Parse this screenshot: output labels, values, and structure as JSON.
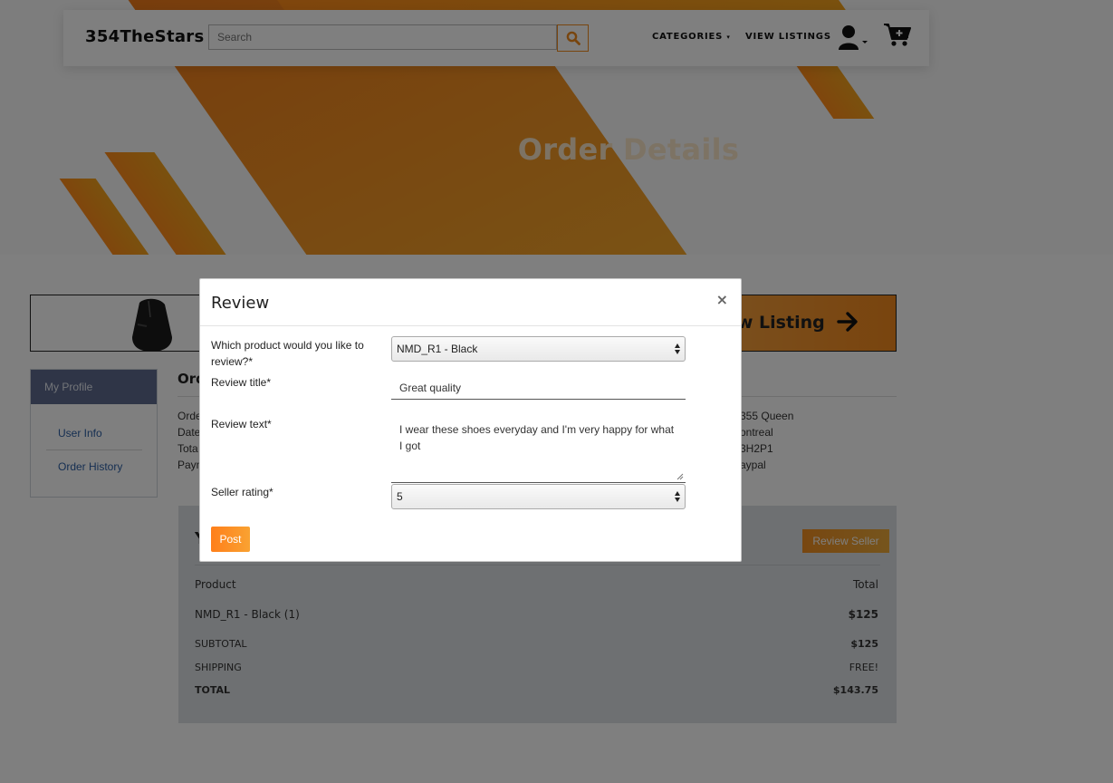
{
  "navbar": {
    "brand": "354TheStars",
    "search_placeholder": "Search",
    "categories_label": "CATEGORIES",
    "view_listings_label": "VIEW LISTINGS"
  },
  "hero": {
    "title": "Order Details"
  },
  "listing_banner": {
    "label": "ew Listing"
  },
  "profile": {
    "header": "My Profile",
    "links": [
      "User Info",
      "Order History"
    ]
  },
  "order": {
    "heading_partial": "Ord",
    "left_fragments": [
      "Orde",
      "Date",
      "Tota",
      "Paym"
    ],
    "right_fragments": [
      "355 Queen",
      "ontreal",
      "3H2P1",
      "aypal"
    ]
  },
  "summary": {
    "heading_partial": "Y",
    "review_seller_label": "Review Seller",
    "col_product": "Product",
    "col_total": "Total",
    "item_name": "NMD_R1 - Black (1)",
    "item_total": "$125",
    "subtotal_label": "SUBTOTAL",
    "subtotal_value": "$125",
    "shipping_label": "SHIPPING",
    "shipping_value": "FREE!",
    "total_label": "TOTAL",
    "total_value": "$143.75"
  },
  "modal": {
    "title": "Review",
    "close_glyph": "×",
    "product_label": "Which product would you like to review?*",
    "product_selected": "NMD_R1 - Black",
    "title_label": "Review title*",
    "title_value": "Great quality",
    "text_label": "Review text*",
    "text_value": "I wear these shoes everyday and I'm very happy for what I got",
    "rating_label": "Seller rating*",
    "rating_selected": "5",
    "post_label": "Post"
  },
  "colors": {
    "accent_orange": "#f08a1c",
    "profile_header": "#5f6b8e",
    "link_blue": "#2d5fa5",
    "summary_bg": "#dde1e4"
  },
  "icons": [
    "search-icon",
    "user-icon",
    "cart-icon",
    "arrow-right-icon",
    "close-icon",
    "select-arrows-icon",
    "mouse-product-image"
  ]
}
